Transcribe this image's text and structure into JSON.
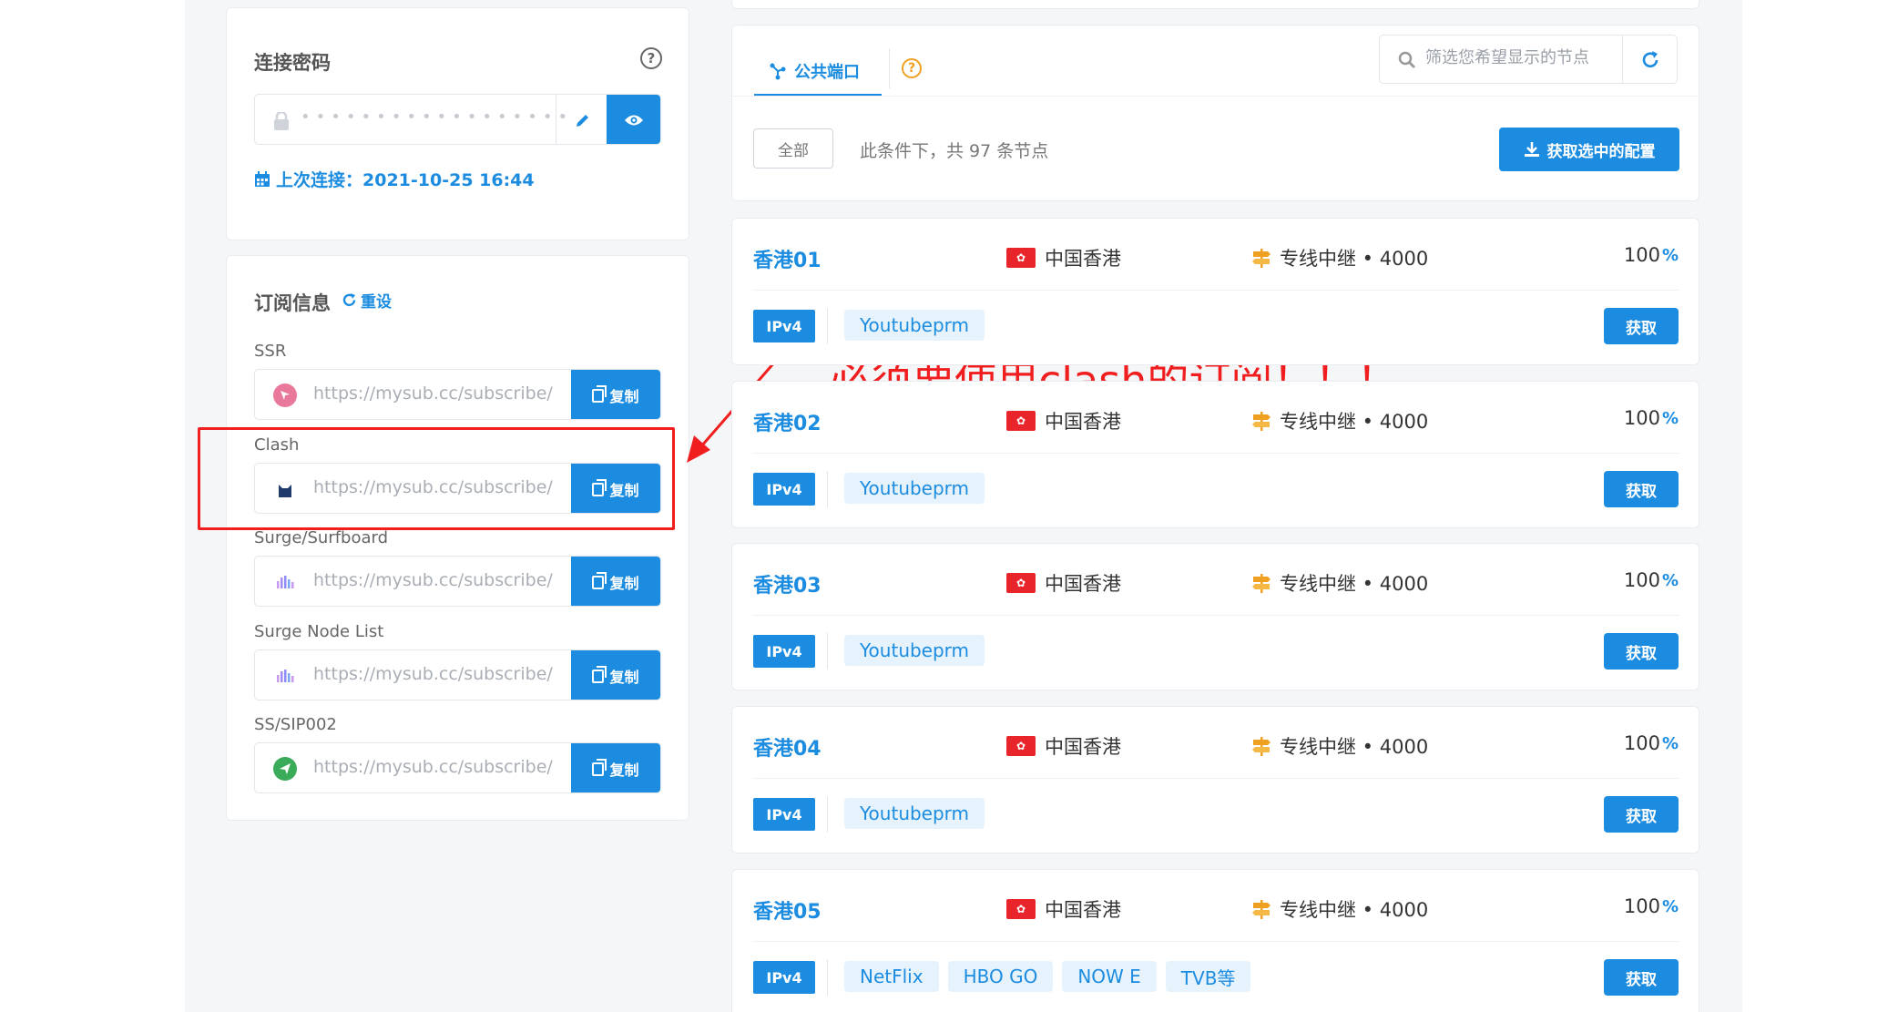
{
  "password": {
    "title": "连接密码",
    "help_icon": "?",
    "masked_value": "••••••••••••••••••",
    "last_connect_label": "上次连接：2021-10-25 16:44"
  },
  "subscription": {
    "title": "订阅信息",
    "reset_label": "重设",
    "copy_label": "复制",
    "items": [
      {
        "label": "SSR",
        "url": "https://mysub.cc/subscribe/"
      },
      {
        "label": "Clash",
        "url": "https://mysub.cc/subscribe/"
      },
      {
        "label": "Surge/Surfboard",
        "url": "https://mysub.cc/subscribe/"
      },
      {
        "label": "Surge Node List",
        "url": "https://mysub.cc/subscribe/"
      },
      {
        "label": "SS/SIP002",
        "url": "https://mysub.cc/subscribe/"
      }
    ]
  },
  "annotation": {
    "text": "必须要使用clash的订阅！！！"
  },
  "filter": {
    "tab_label": "公共端口",
    "tab_help": "?",
    "search_placeholder": "筛选您希望显示的节点",
    "all_label": "全部",
    "count_text": "此条件下，共 97 条节点",
    "fetch_selected_label": "获取选中的配置"
  },
  "nodes": [
    {
      "name": "香港01",
      "region": "中国香港",
      "line": "专线中继 • 4000",
      "pct": "100",
      "proto": "IPv4",
      "tags": [
        "Youtubeprm"
      ],
      "action": "获取"
    },
    {
      "name": "香港02",
      "region": "中国香港",
      "line": "专线中继 • 4000",
      "pct": "100",
      "proto": "IPv4",
      "tags": [
        "Youtubeprm"
      ],
      "action": "获取"
    },
    {
      "name": "香港03",
      "region": "中国香港",
      "line": "专线中继 • 4000",
      "pct": "100",
      "proto": "IPv4",
      "tags": [
        "Youtubeprm"
      ],
      "action": "获取"
    },
    {
      "name": "香港04",
      "region": "中国香港",
      "line": "专线中继 • 4000",
      "pct": "100",
      "proto": "IPv4",
      "tags": [
        "Youtubeprm"
      ],
      "action": "获取"
    },
    {
      "name": "香港05",
      "region": "中国香港",
      "line": "专线中继 • 4000",
      "pct": "100",
      "proto": "IPv4",
      "tags": [
        "NetFlix",
        "HBO GO",
        "NOW E",
        "TVB等"
      ],
      "action": "获取"
    }
  ],
  "colors": {
    "accent": "#1c8ce0",
    "annotation_red": "#f01e1e",
    "flag_red": "#e8252a",
    "relay_orange": "#f0a020"
  }
}
